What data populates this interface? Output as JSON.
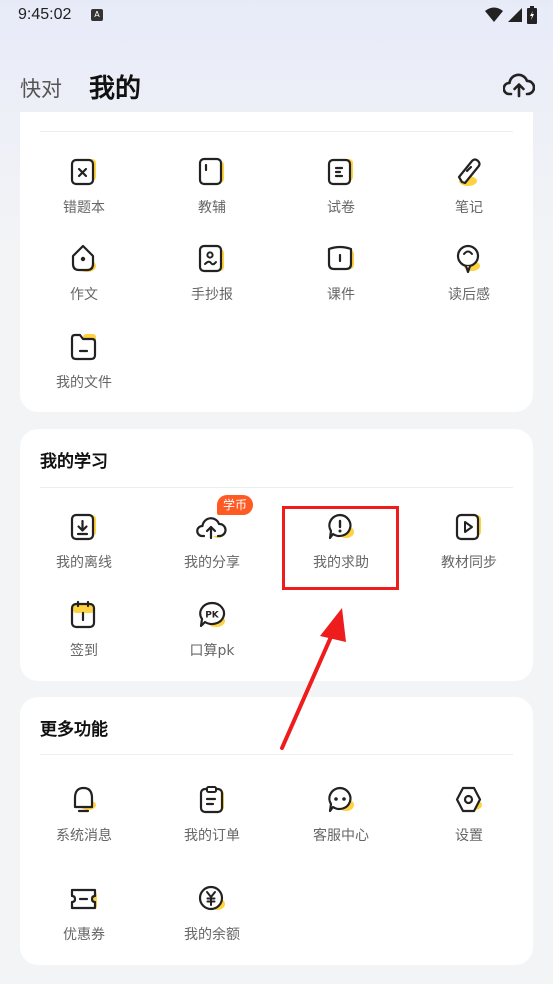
{
  "status_bar": {
    "time": "9:45:02",
    "app_icon_letter": "A"
  },
  "header": {
    "tabs": [
      {
        "label": "快对"
      },
      {
        "label": "我的"
      }
    ]
  },
  "tools": {
    "items": [
      {
        "label": "错题本",
        "icon": "wrong-questions-icon"
      },
      {
        "label": "教辅",
        "icon": "textbook-aid-icon"
      },
      {
        "label": "试卷",
        "icon": "exam-paper-icon"
      },
      {
        "label": "笔记",
        "icon": "notes-icon"
      },
      {
        "label": "作文",
        "icon": "essay-icon"
      },
      {
        "label": "手抄报",
        "icon": "handwritten-poster-icon"
      },
      {
        "label": "课件",
        "icon": "courseware-icon"
      },
      {
        "label": "读后感",
        "icon": "reflection-icon"
      },
      {
        "label": "我的文件",
        "icon": "folder-icon"
      }
    ]
  },
  "study": {
    "title": "我的学习",
    "badge": "学币",
    "items": [
      {
        "label": "我的离线",
        "icon": "offline-download-icon"
      },
      {
        "label": "我的分享",
        "icon": "share-cloud-icon"
      },
      {
        "label": "我的求助",
        "icon": "help-request-icon"
      },
      {
        "label": "教材同步",
        "icon": "textbook-sync-icon"
      },
      {
        "label": "签到",
        "icon": "check-in-icon"
      },
      {
        "label": "口算pk",
        "icon": "pk-icon"
      }
    ]
  },
  "more": {
    "title": "更多功能",
    "items": [
      {
        "label": "系统消息",
        "icon": "bell-icon"
      },
      {
        "label": "我的订单",
        "icon": "order-clipboard-icon"
      },
      {
        "label": "客服中心",
        "icon": "customer-service-chat-icon"
      },
      {
        "label": "设置",
        "icon": "settings-hexagon-icon"
      },
      {
        "label": "优惠券",
        "icon": "coupon-icon"
      },
      {
        "label": "我的余额",
        "icon": "balance-yen-icon"
      }
    ]
  },
  "colors": {
    "accent_yellow": "#ffd23f",
    "highlight_red": "#ee1c1c",
    "badge_orange": "#ff5a24"
  }
}
